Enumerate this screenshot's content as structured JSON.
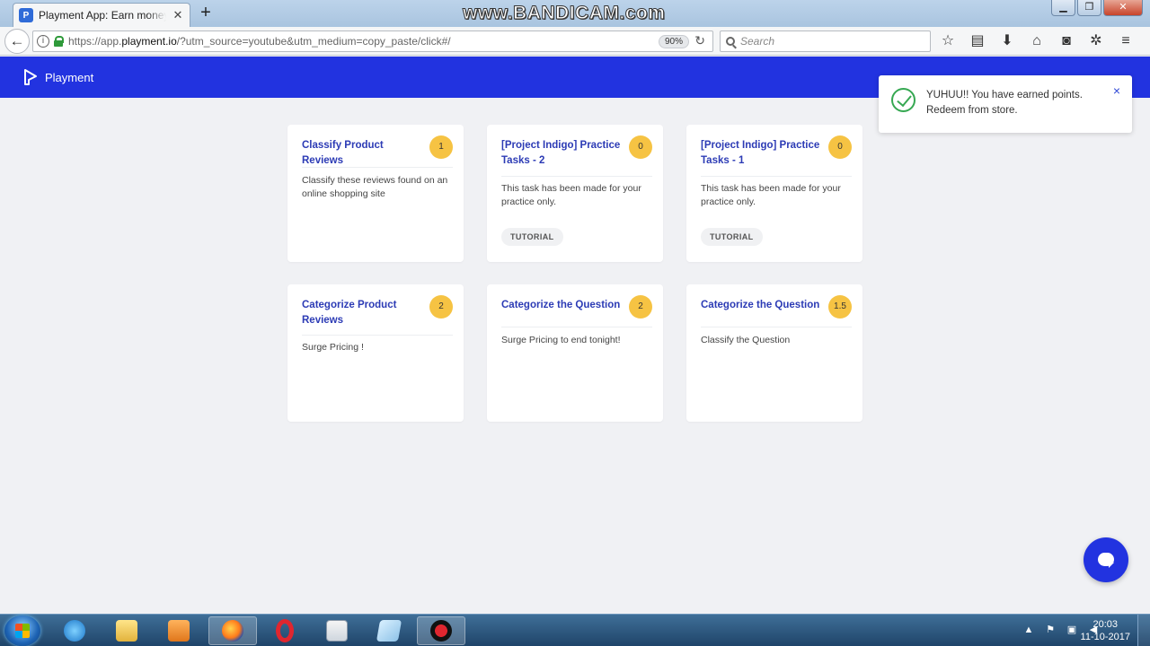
{
  "browser": {
    "tab_title": "Playment App: Earn money b",
    "tab_close": "✕",
    "new_tab": "+",
    "watermark": "www.BANDICAM.com",
    "url_prefix": "https://app.",
    "url_domain": "playment.io",
    "url_rest": "/?utm_source=youtube&utm_medium=copy_paste/click#/",
    "zoom": "90%",
    "search_placeholder": "Search"
  },
  "app": {
    "brand_name": "Playment",
    "colors": {
      "header": "#2233e0",
      "card_title": "#2c3bb5",
      "badge": "#f6c343",
      "success": "#36a852"
    }
  },
  "toast": {
    "message": "YUHUU!! You have earned points. Redeem from store.",
    "close": "×"
  },
  "tasks": [
    {
      "title": "Classify Product Reviews",
      "points": "1",
      "description": "Classify these reviews found on an online shopping site",
      "tag": ""
    },
    {
      "title": "[Project Indigo] Practice Tasks - 2",
      "points": "0",
      "description": "This task has been made for your practice only.",
      "tag": "TUTORIAL"
    },
    {
      "title": "[Project Indigo] Practice Tasks - 1",
      "points": "0",
      "description": "This task has been made for your practice only.",
      "tag": "TUTORIAL"
    },
    {
      "title": "Categorize Product Reviews",
      "points": "2",
      "description": "Surge Pricing !",
      "tag": ""
    },
    {
      "title": "Categorize the Question",
      "points": "2",
      "description": "Surge Pricing to end tonight!",
      "tag": ""
    },
    {
      "title": "Categorize the Question",
      "points": "1.5",
      "description": "Classify the Question",
      "tag": ""
    }
  ],
  "taskbar": {
    "time": "20:03",
    "date": "11-10-2017"
  }
}
